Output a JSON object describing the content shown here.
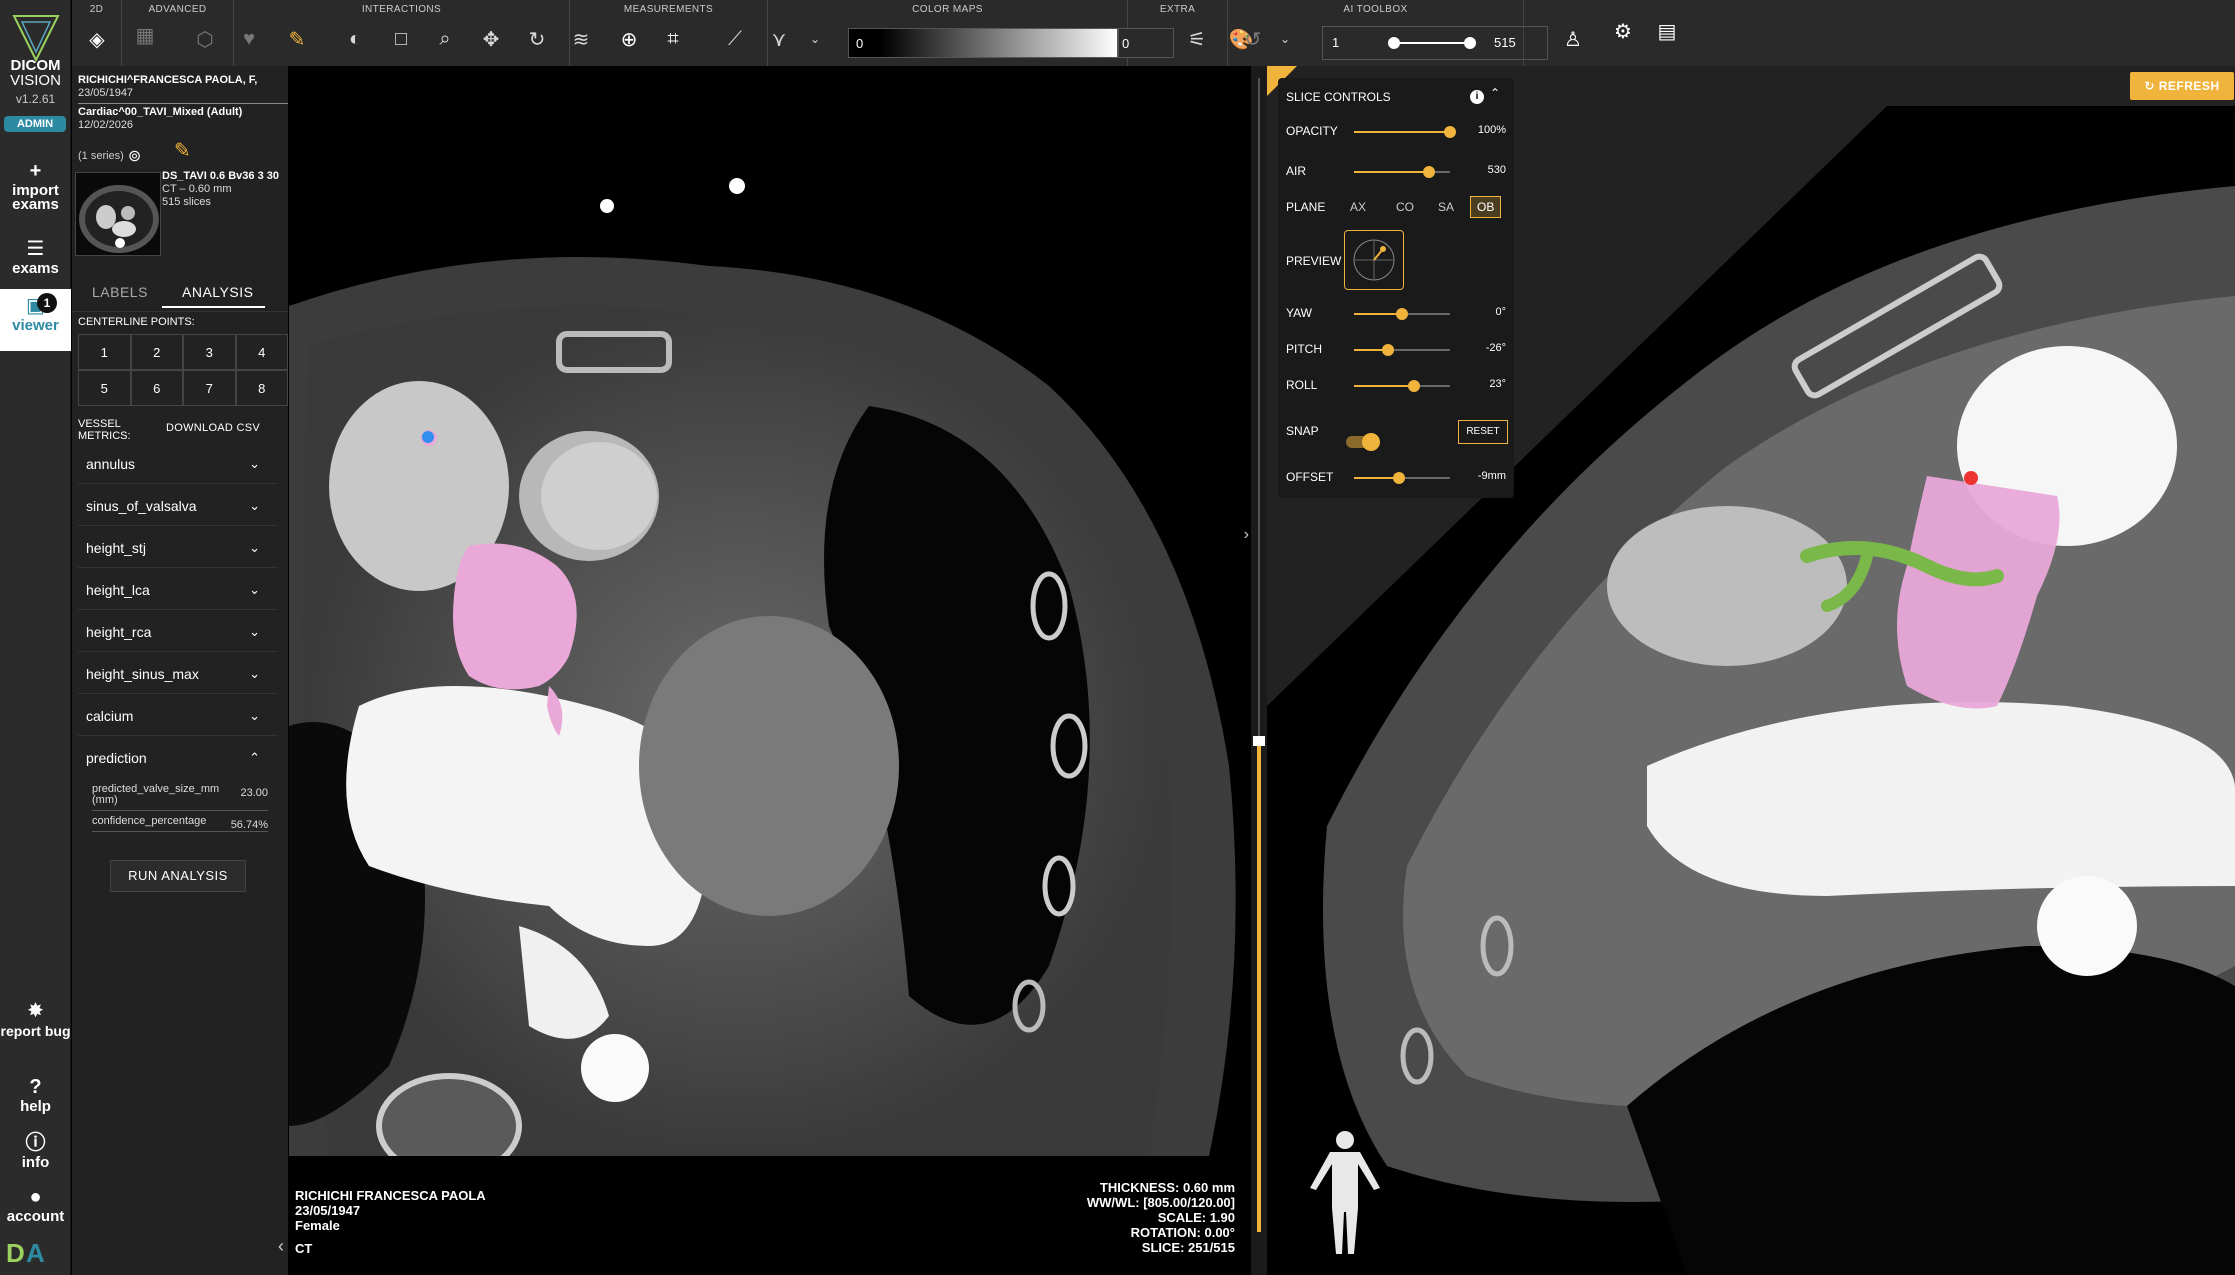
{
  "app": {
    "brand_line1": "DICOM",
    "brand_line2": "VISION",
    "version": "v1.2.61",
    "role": "ADMIN"
  },
  "nav": {
    "import": "import exams",
    "exams": "exams",
    "viewer": "viewer",
    "viewer_badge": "1",
    "report_bug": "report bug",
    "help": "help",
    "info": "info",
    "account": "account"
  },
  "patient": {
    "name_line": "RICHICHI^FRANCESCA PAOLA, F,",
    "dob": "23/05/1947",
    "study_name": "Cardiac^00_TAVI_Mixed (Adult)",
    "study_date": "12/02/2026",
    "series_count": "(1 series)",
    "series_name": "DS_TAVI 0.6 Bv36 3 30",
    "series_modality": "CT – 0.60 mm",
    "series_slices": "515 slices"
  },
  "panel": {
    "tabs": [
      "LABELS",
      "ANALYSIS"
    ],
    "active_tab": "ANALYSIS",
    "centerline_label": "CENTERLINE POINTS:",
    "centerline_points": [
      "1",
      "2",
      "3",
      "4",
      "5",
      "6",
      "7",
      "8"
    ],
    "vessel_metrics_label": "VESSEL METRICS:",
    "download_csv": "DOWNLOAD CSV",
    "metrics": [
      "annulus",
      "sinus_of_valsalva",
      "height_stj",
      "height_lca",
      "height_rca",
      "height_sinus_max",
      "calcium",
      "prediction"
    ],
    "prediction_rows": [
      {
        "label": "predicted_valve_size_mm (mm)",
        "value": "23.00"
      },
      {
        "label": "confidence_percentage",
        "value": "56.74%"
      }
    ],
    "run_analysis": "RUN ANALYSIS"
  },
  "toolbar": {
    "groups": [
      "2D",
      "ADVANCED",
      "INTERACTIONS",
      "MEASUREMENTS",
      "COLOR MAPS",
      "EXTRA",
      "AI TOOLBOX"
    ],
    "colormap_min": "0",
    "colormap_max": "0",
    "range_min": "1",
    "range_max": "515"
  },
  "left_viewport": {
    "patient_name": "RICHICHI FRANCESCA PAOLA",
    "dob": "23/05/1947",
    "sex": "Female",
    "modality": "CT",
    "thickness": "THICKNESS: 0.60 mm",
    "wwwl": "WW/WL: [805.00/120.00]",
    "scale": "SCALE: 1.90",
    "rotation": "ROTATION: 0.00°",
    "slice": "SLICE: 251/515"
  },
  "slice_controls": {
    "title": "SLICE CONTROLS",
    "opacity_label": "OPACITY",
    "opacity_value": "100%",
    "opacity_level": 1.0,
    "air_label": "AIR",
    "air_value": "530",
    "air_level": 0.78,
    "plane_label": "PLANE",
    "planes": [
      "AX",
      "CO",
      "SA",
      "OB"
    ],
    "active_plane": "OB",
    "preview_label": "PREVIEW",
    "yaw_label": "YAW",
    "yaw_value": "0°",
    "yaw_level": 0.5,
    "pitch_label": "PITCH",
    "pitch_value": "-26°",
    "pitch_level": 0.35,
    "roll_label": "ROLL",
    "roll_value": "23°",
    "roll_level": 0.62,
    "snap_label": "SNAP",
    "reset": "RESET",
    "offset_label": "OFFSET",
    "offset_value": "-9mm",
    "offset_level": 0.47
  },
  "refresh": "REFRESH",
  "colors": {
    "accent": "#f0b43c",
    "teal": "#2c8aa3",
    "segmentation": "#e9a8d8",
    "centerline": "#7bb84a"
  }
}
